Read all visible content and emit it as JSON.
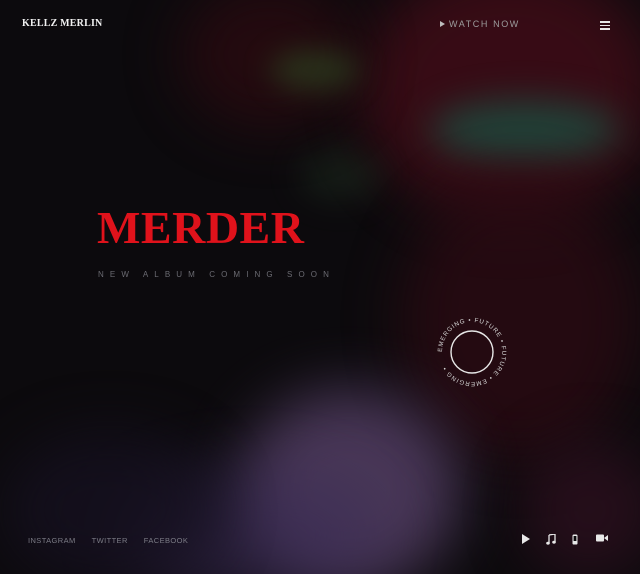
{
  "header": {
    "logo": "KELLZ MERLIN",
    "watch_label": "WATCH NOW",
    "menu_icon": "hamburger-menu-icon"
  },
  "hero": {
    "title": "MERDER",
    "subtitle": "NEW ALBUM COMING SOON"
  },
  "badge": {
    "text": "EMERGING • FUTURE • FUTURE • EMERGING • "
  },
  "footer": {
    "social": [
      "INSTAGRAM",
      "TWITTER",
      "FACEBOOK"
    ],
    "icons": [
      "play-icon",
      "music-note-icon",
      "phone-icon",
      "video-camera-icon"
    ]
  },
  "colors": {
    "background": "#0c0a0d",
    "accent": "#e0121b",
    "muted_text": "#6b6b72"
  }
}
